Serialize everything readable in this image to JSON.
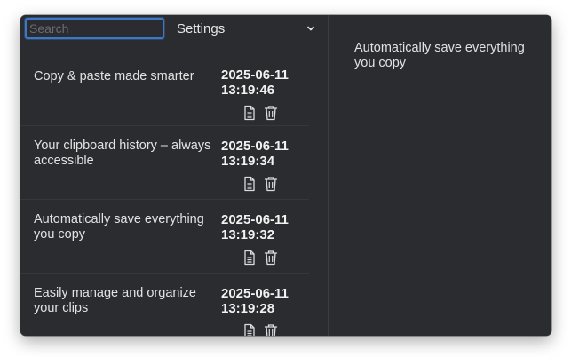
{
  "search": {
    "placeholder": "Search",
    "value": ""
  },
  "settings": {
    "label": "Settings"
  },
  "clips": [
    {
      "text": "Copy & paste made smarter",
      "date": "2025-06-11\n13:19:46"
    },
    {
      "text": "Your clipboard history – always accessible",
      "date": "2025-06-11\n13:19:34"
    },
    {
      "text": "Automatically save everything you copy",
      "date": "2025-06-11\n13:19:32"
    },
    {
      "text": "Easily manage and organize your clips",
      "date": "2025-06-11\n13:19:28"
    }
  ],
  "preview": {
    "text": "Automatically save everything you copy"
  },
  "icons": {
    "copy": "document-icon",
    "delete": "trash-icon",
    "dropdown": "chevron-down-icon"
  },
  "colors": {
    "background": "#2b2c30",
    "focus_ring": "#3a78c8",
    "text": "#e2e2e2"
  }
}
